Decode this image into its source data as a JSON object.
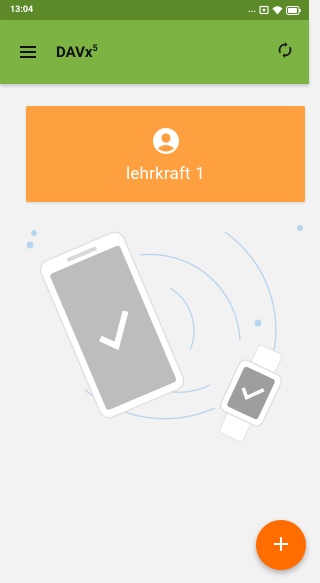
{
  "status_bar": {
    "time": "13:04",
    "extra": "..."
  },
  "app_bar": {
    "title": "DAVx",
    "title_sup": "5"
  },
  "account": {
    "name": "lehrkraft 1"
  },
  "colors": {
    "status_bar": "#5c8a29",
    "app_bar": "#7cb342",
    "account_card": "#ffa040",
    "fab": "#ff6d00"
  },
  "icons": {
    "menu": "menu-icon",
    "sync": "sync-icon",
    "account": "account-circle-icon",
    "fab": "plus-icon"
  }
}
